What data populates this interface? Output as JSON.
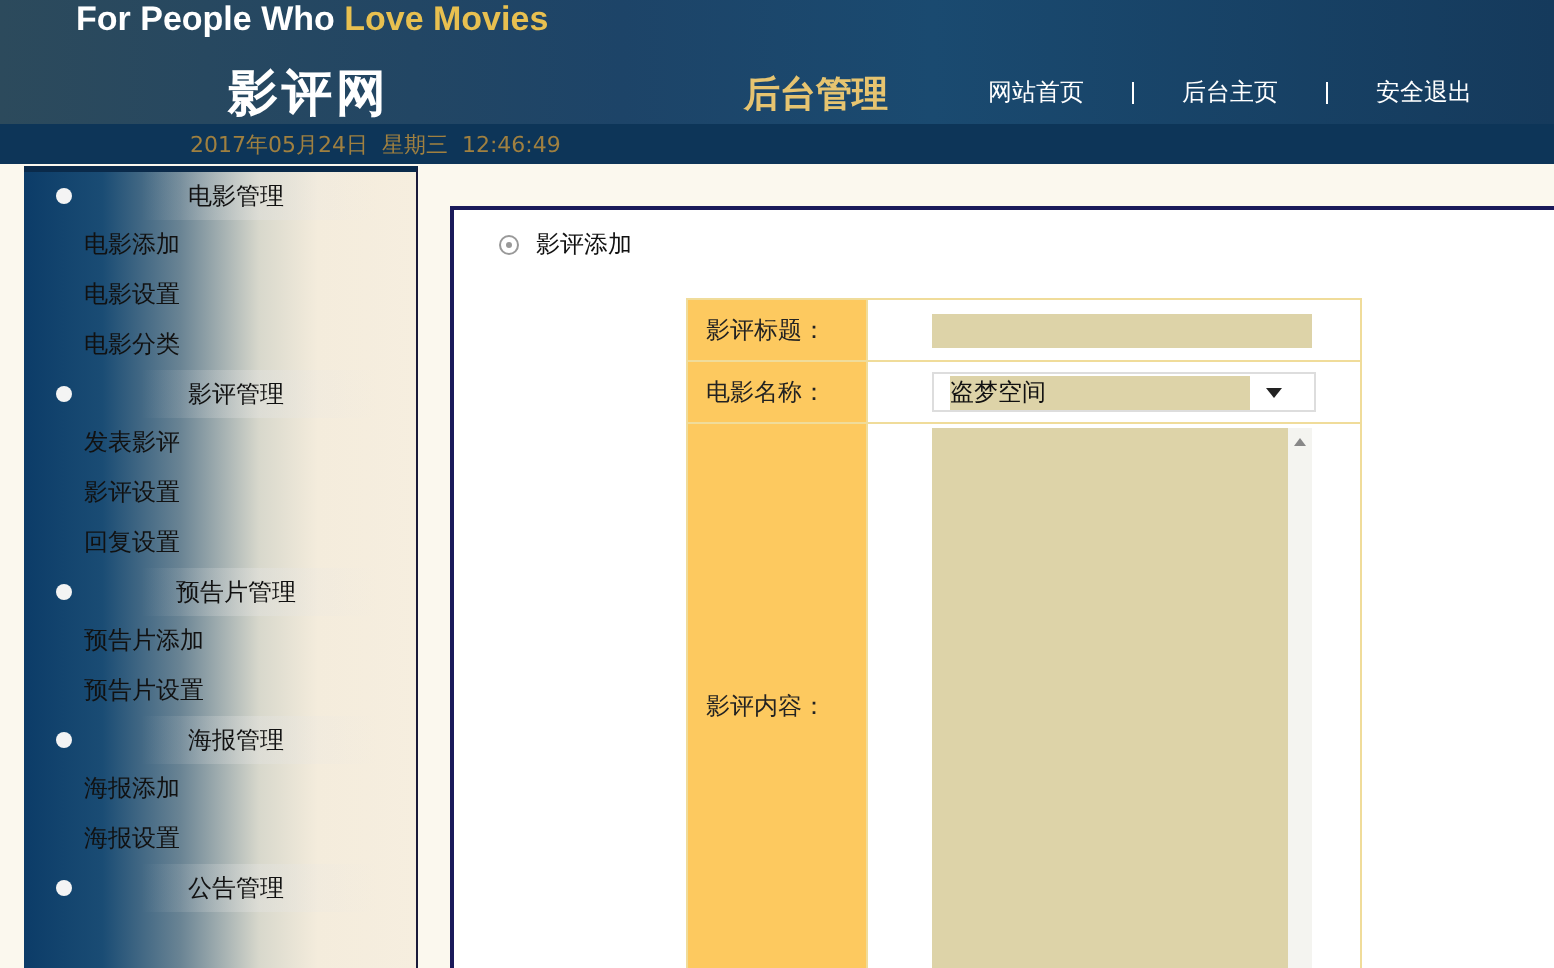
{
  "header": {
    "slogan_start": "For People Who",
    "slogan_end": "Love Movies",
    "site_name": "影评网",
    "section": "后台管理",
    "nav": [
      {
        "label": "网站首页"
      },
      {
        "label": "后台主页"
      },
      {
        "label": "安全退出"
      }
    ],
    "datetime": "2017年05月24日  星期三  12:46:49"
  },
  "sidebar": [
    {
      "title": "电影管理",
      "items": [
        "电影添加",
        "电影设置",
        "电影分类"
      ]
    },
    {
      "title": "影评管理",
      "items": [
        "发表影评",
        "影评设置",
        "回复设置"
      ]
    },
    {
      "title": "预告片管理",
      "items": [
        "预告片添加",
        "预告片设置"
      ]
    },
    {
      "title": "海报管理",
      "items": [
        "海报添加",
        "海报设置"
      ]
    },
    {
      "title": "公告管理"
    }
  ],
  "panel": {
    "title": "影评添加",
    "form": [
      {
        "kind": "text",
        "label": "影评标题："
      },
      {
        "kind": "select",
        "label": "电影名称：",
        "value": "盗梦空间"
      },
      {
        "kind": "textarea",
        "label": "影评内容："
      }
    ]
  }
}
